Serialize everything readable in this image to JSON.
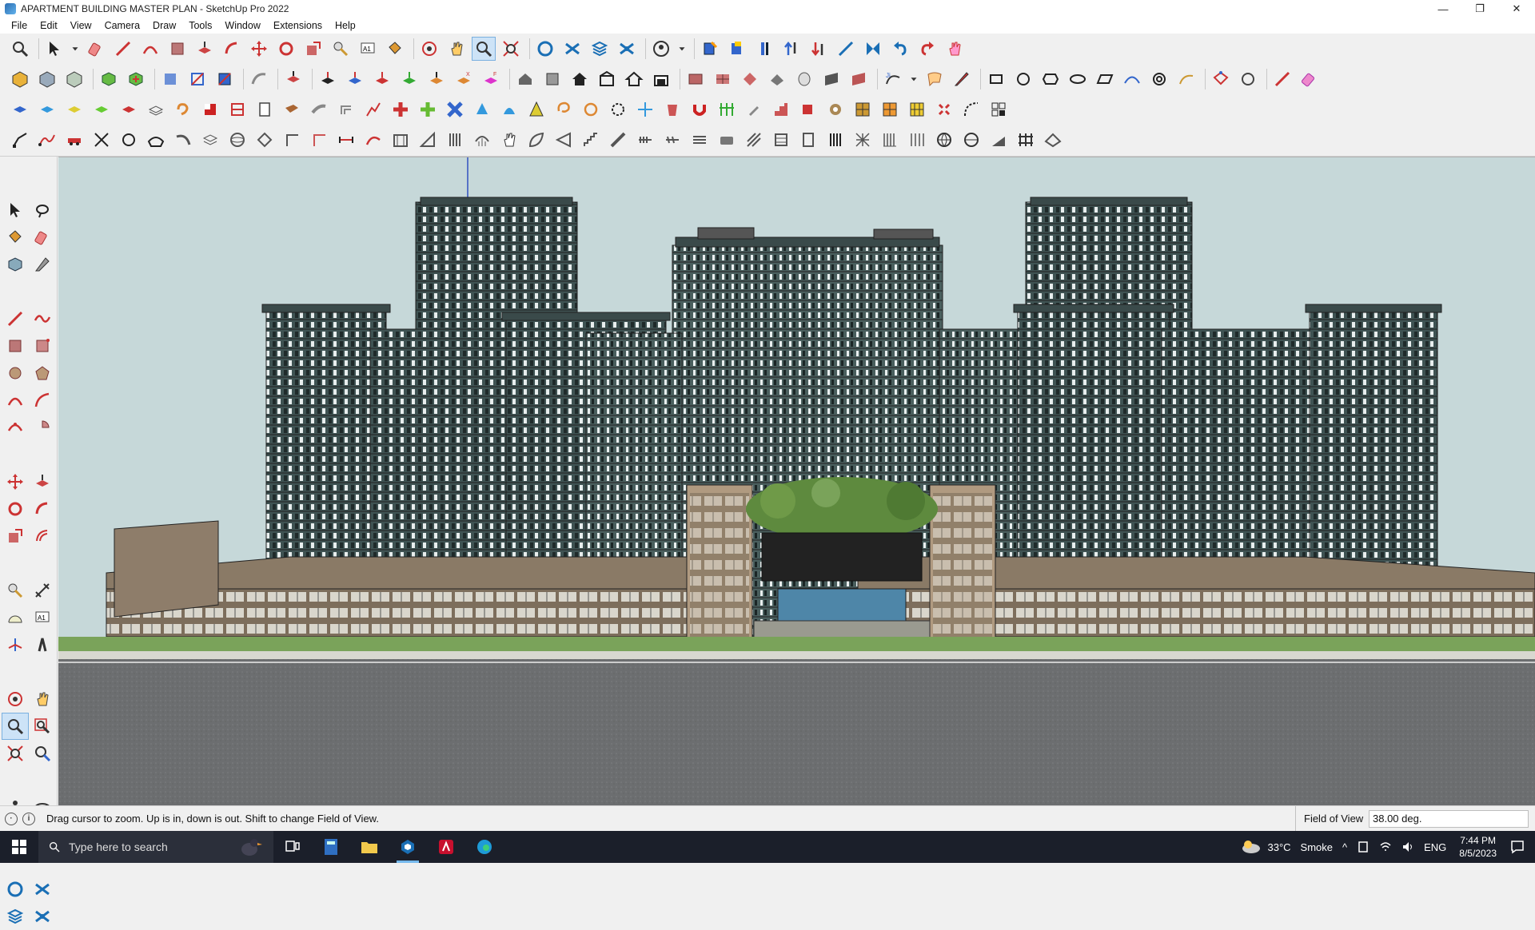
{
  "window": {
    "title": "APARTMENT BUILDING MASTER PLAN - SketchUp Pro 2022",
    "minimize": "—",
    "maximize": "❐",
    "close": "✕"
  },
  "menu": [
    "File",
    "Edit",
    "View",
    "Camera",
    "Draw",
    "Tools",
    "Window",
    "Extensions",
    "Help"
  ],
  "status": {
    "hint": "Drag cursor to zoom.  Up is in, down is out. Shift to change Field of View.",
    "vcb_label": "Field of View",
    "vcb_value": "38.00 deg."
  },
  "taskbar": {
    "search_placeholder": "Type here to search",
    "weather_temp": "33°C",
    "weather_desc": "Smoke",
    "language": "ENG",
    "time": "7:44 PM",
    "date": "8/5/2023"
  },
  "colors": {
    "sky": "#c6d8d9",
    "tower": "#4f6666",
    "podium": "#8a7a66",
    "ground": "#6e7072",
    "grass": "#7aa35a",
    "taskbar": "#1b1f2a"
  }
}
